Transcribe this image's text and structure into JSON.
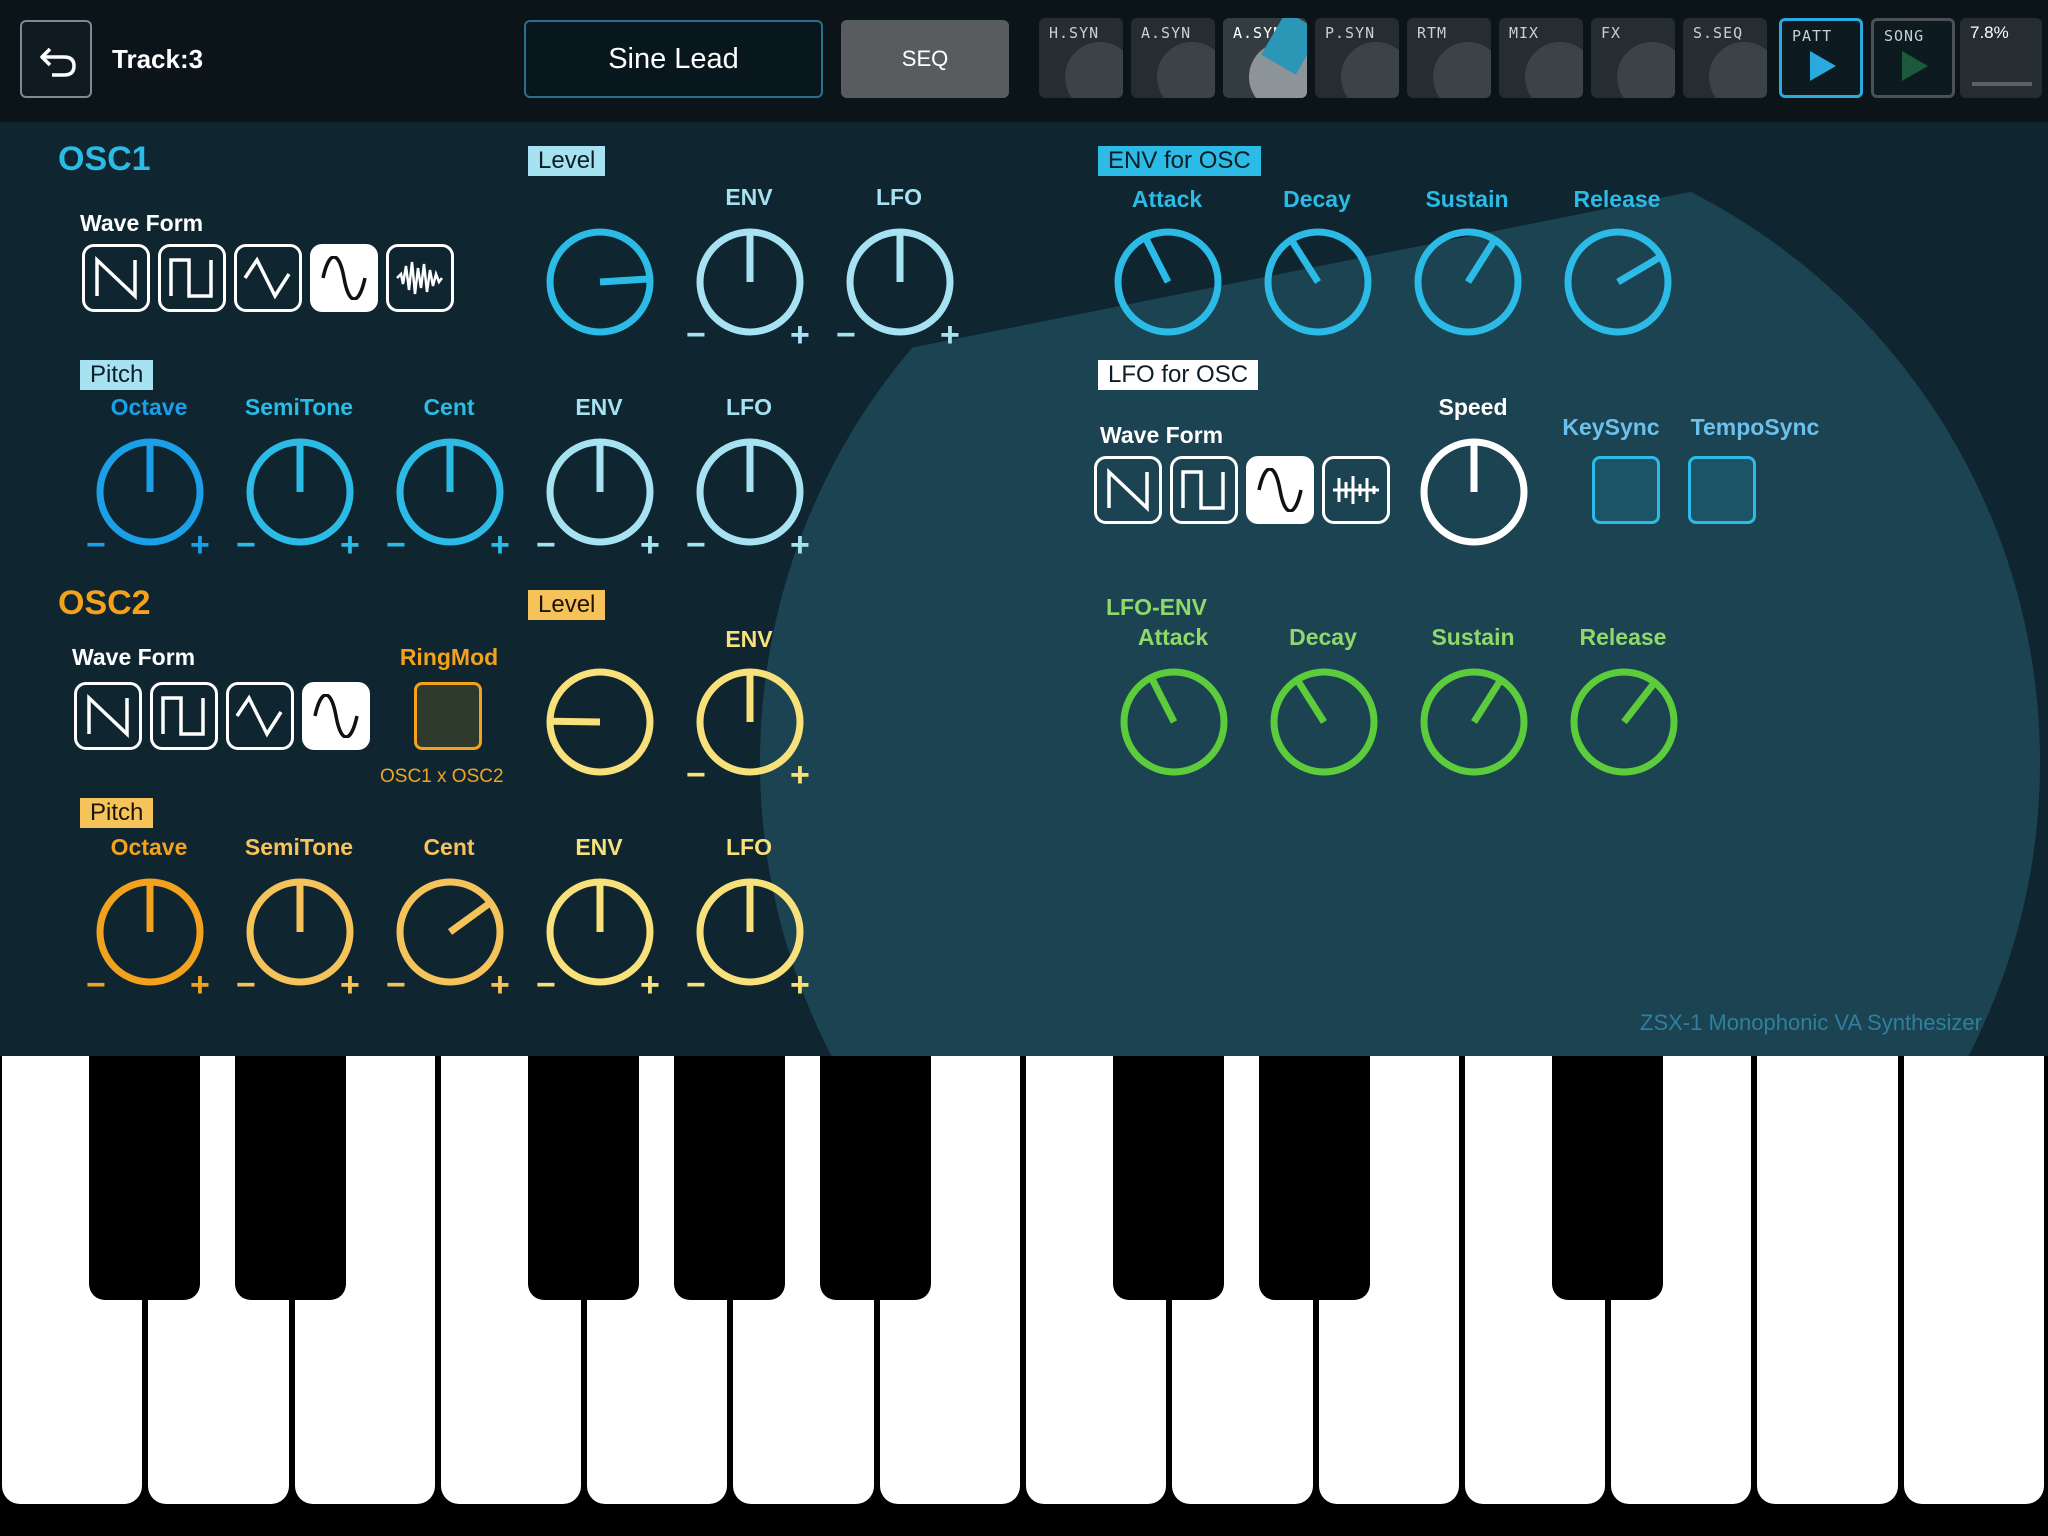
{
  "topbar": {
    "track": "Track:3",
    "patch_name": "Sine Lead",
    "seq_label": "SEQ",
    "tabs": [
      "H.SYN",
      "A.SYN",
      "A.SYN",
      "P.SYN",
      "RTM",
      "MIX",
      "FX",
      "S.SEQ",
      "PATT",
      "SONG"
    ],
    "active_tab": 2,
    "cpu": "7.8%"
  },
  "osc1": {
    "title": "OSC1",
    "waveform_label": "Wave Form",
    "level_tag": "Level",
    "env_label": "ENV",
    "lfo_label": "LFO",
    "pitch_tag": "Pitch",
    "octave_label": "Octave",
    "semitone_label": "SemiTone",
    "cent_label": "Cent",
    "pitch_env_label": "ENV",
    "pitch_lfo_label": "LFO",
    "waveforms": [
      "saw",
      "square",
      "triangle",
      "sine",
      "noise"
    ],
    "selected_waveform": "sine",
    "knobs": {
      "level": 0.82,
      "env": 0.5,
      "lfo": 0.5,
      "octave": 0.5,
      "semitone": 0.5,
      "cent": 0.5,
      "pitch_env": 0.5,
      "pitch_lfo": 0.5
    }
  },
  "osc2": {
    "title": "OSC2",
    "waveform_label": "Wave Form",
    "ringmod_label": "RingMod",
    "ringmod_caption": "OSC1 x OSC2",
    "level_tag": "Level",
    "env_label": "ENV",
    "pitch_tag": "Pitch",
    "octave_label": "Octave",
    "semitone_label": "SemiTone",
    "cent_label": "Cent",
    "pitch_env_label": "ENV",
    "pitch_lfo_label": "LFO",
    "waveforms": [
      "saw",
      "square",
      "triangle",
      "sine"
    ],
    "selected_waveform": "sine",
    "knobs": {
      "level": 0.17,
      "env": 0.5,
      "octave": 0.5,
      "semitone": 0.5,
      "cent": 0.7,
      "pitch_env": 0.5,
      "pitch_lfo": 0.5
    }
  },
  "env_osc": {
    "tag": "ENV for OSC",
    "attack_label": "Attack",
    "decay_label": "Decay",
    "sustain_label": "Sustain",
    "release_label": "Release",
    "knobs": {
      "attack": 0.4,
      "decay": 0.38,
      "sustain": 0.62,
      "release": 0.72
    }
  },
  "lfo_osc": {
    "tag": "LFO for OSC",
    "waveform_label": "Wave Form",
    "speed_label": "Speed",
    "keysync_label": "KeySync",
    "temposync_label": "TempoSync",
    "waveforms": [
      "saw",
      "square",
      "sine",
      "sample-hold"
    ],
    "selected_waveform": "sine",
    "speed": 0.5
  },
  "lfo_env": {
    "title": "LFO-ENV",
    "attack_label": "Attack",
    "decay_label": "Decay",
    "sustain_label": "Sustain",
    "release_label": "Release",
    "knobs": {
      "attack": 0.4,
      "decay": 0.38,
      "sustain": 0.62,
      "release": 0.64
    }
  },
  "brand": "ZSX-1 Monophonic VA Synthesizer",
  "colors": {
    "osc1": "#2bbbe6",
    "osc1_light": "#a6e2f2",
    "osc1_pitch": "#1a9fe8",
    "osc2": "#f2a21c",
    "osc2_light": "#f8e07a",
    "osc2_mid": "#f6c35a",
    "lfo_env": "#5ccb3c",
    "white": "#ffffff"
  },
  "keyboard": {
    "white_keys": 14,
    "black_keys": 8
  }
}
